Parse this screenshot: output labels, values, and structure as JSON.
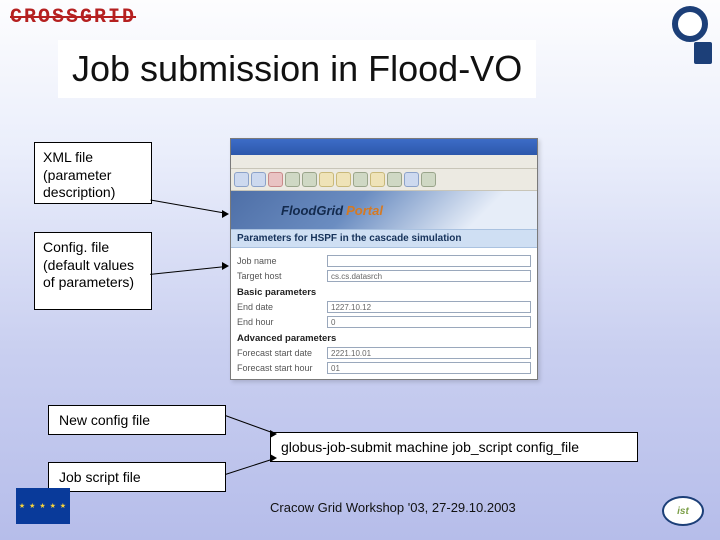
{
  "header": {
    "crossgrid": "CROSSGRID"
  },
  "title": "Job submission in Flood-VO",
  "inputs": {
    "xml": "XML file (parameter description)",
    "cfg": "Config. file (default values of parameters)"
  },
  "portal": {
    "banner_left": "FloodGrid",
    "banner_right": "Portal",
    "section_title": "Parameters for HSPF in the cascade simulation",
    "rows": {
      "jobname_label": "Job name",
      "jobname_value": "",
      "target_label": "Target host",
      "target_value": "cs.cs.datasrch",
      "basic_heading": "Basic parameters",
      "enddate_label": "End date",
      "enddate_value": "1227.10.12",
      "endhour_label": "End hour",
      "endhour_value": "0",
      "adv_heading": "Advanced parameters",
      "fcstart_label": "Forecast start date",
      "fcstart_value": "2221.10.01",
      "fchour_label": "Forecast start hour",
      "fchour_value": "01"
    }
  },
  "flow": {
    "newcfg": "New config file",
    "script": "Job script file",
    "command": "globus-job-submit machine job_script config_file"
  },
  "footer": {
    "text": "Cracow Grid Workshop '03, 27-29.10.2003",
    "ist": "ist"
  }
}
